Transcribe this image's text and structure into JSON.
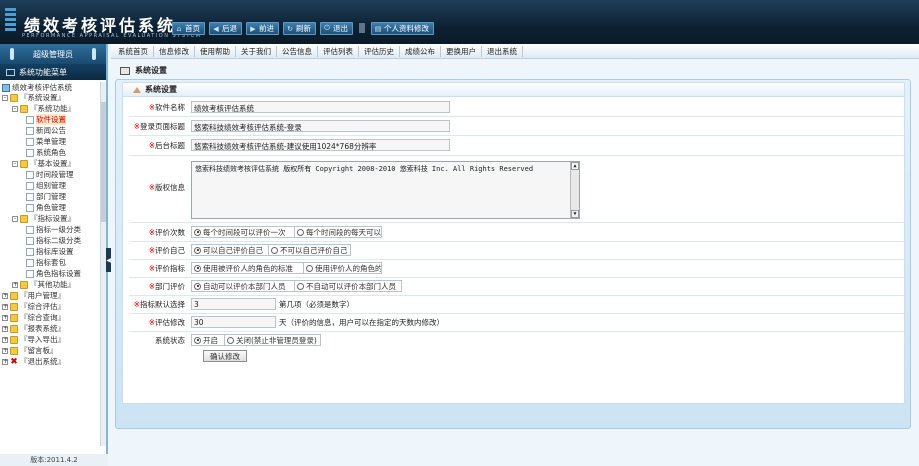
{
  "header": {
    "app_title": "绩效考核评估系统",
    "app_subtitle": "PERFORMANCE APPRAISAL EVALUATION SYSTEM",
    "buttons": [
      {
        "label": "首页",
        "icon": "home-icon"
      },
      {
        "label": "后退",
        "icon": "back-icon"
      },
      {
        "label": "前进",
        "icon": "forward-icon"
      },
      {
        "label": "刷新",
        "icon": "refresh-icon"
      },
      {
        "label": "退出",
        "icon": "power-icon"
      },
      {
        "label": "个人资料修改",
        "icon": "profile-icon"
      }
    ]
  },
  "sidebar": {
    "user_role": "超级管理员",
    "menu_header": "系统功能菜单",
    "version": "版本:2011.4.2",
    "tree": [
      {
        "label": "绩效考核评估系统",
        "level": 0,
        "icon": "pc"
      },
      {
        "label": "『系统设置』",
        "level": 0,
        "icon": "folder",
        "toggle": "-"
      },
      {
        "label": "『系统功能』",
        "level": 1,
        "icon": "folder",
        "toggle": "-"
      },
      {
        "label": "软件设置",
        "level": 2,
        "icon": "page",
        "selected": true
      },
      {
        "label": "新闻公告",
        "level": 2,
        "icon": "page"
      },
      {
        "label": "菜单管理",
        "level": 2,
        "icon": "page"
      },
      {
        "label": "系统角色",
        "level": 2,
        "icon": "page"
      },
      {
        "label": "『基本设置』",
        "level": 1,
        "icon": "folder",
        "toggle": "-"
      },
      {
        "label": "时间段管理",
        "level": 2,
        "icon": "page"
      },
      {
        "label": "组别管理",
        "level": 2,
        "icon": "page"
      },
      {
        "label": "部门管理",
        "level": 2,
        "icon": "page"
      },
      {
        "label": "角色管理",
        "level": 2,
        "icon": "page"
      },
      {
        "label": "『指标设置』",
        "level": 1,
        "icon": "folder",
        "toggle": "-"
      },
      {
        "label": "指标一级分类",
        "level": 2,
        "icon": "page"
      },
      {
        "label": "指标二级分类",
        "level": 2,
        "icon": "page"
      },
      {
        "label": "指标库设置",
        "level": 2,
        "icon": "page"
      },
      {
        "label": "指标套包",
        "level": 2,
        "icon": "page"
      },
      {
        "label": "角色指标设置",
        "level": 2,
        "icon": "page"
      },
      {
        "label": "『其他功能』",
        "level": 1,
        "icon": "folder",
        "toggle": "+"
      },
      {
        "label": "『用户管理』",
        "level": 0,
        "icon": "folder",
        "toggle": "+"
      },
      {
        "label": "『综合评估』",
        "level": 0,
        "icon": "folder",
        "toggle": "+"
      },
      {
        "label": "『综合查询』",
        "level": 0,
        "icon": "folder",
        "toggle": "+"
      },
      {
        "label": "『报表系统』",
        "level": 0,
        "icon": "folder",
        "toggle": "+"
      },
      {
        "label": "『导入导出』",
        "level": 0,
        "icon": "folder",
        "toggle": "+"
      },
      {
        "label": "『留言板』",
        "level": 0,
        "icon": "folder",
        "toggle": "+"
      },
      {
        "label": "『退出系统』",
        "level": 0,
        "icon": "red",
        "toggle": "+"
      }
    ]
  },
  "main_nav": [
    "系统首页",
    "信息修改",
    "使用帮助",
    "关于我们",
    "公告信息",
    "评估列表",
    "评估历史",
    "成绩公布",
    "更换用户",
    "退出系统"
  ],
  "breadcrumb": "系统设置",
  "section_title": "系统设置",
  "form": {
    "software_name_label": "软件名称",
    "software_name_value": "绩效考核评估系统",
    "login_title_label": "登录页面标题",
    "login_title_value": "悠索科技绩效考核评估系统-登录",
    "admin_title_label": "后台标题",
    "admin_title_value": "悠索科技绩效考核评估系统-建议使用1024*768分辨率",
    "copyright_label": "版权信息",
    "copyright_value": "悠索科技绩效考核评估系统 版权所有 Copyright 2008-2010 悠索科技 Inc. All Rights Reserved",
    "eval_count_label": "评价次数",
    "eval_count_opt1": "每个时间段可以评价一次",
    "eval_count_opt2": "每个时间段的每天可以",
    "eval_self_label": "评价自己",
    "eval_self_opt1": "可以自己评价自己",
    "eval_self_opt2": "不可以自己评价自己",
    "eval_index_label": "评价指标",
    "eval_index_opt1": "使用被评价人的角色的标准",
    "eval_index_opt2": "使用评价人的角色的",
    "dept_eval_label": "部门评价",
    "dept_eval_opt1": "自动可以评价本部门人员",
    "dept_eval_opt2": "不自动可以评价本部门人员",
    "index_default_label": "指标默认选择",
    "index_default_value": "3",
    "index_default_hint": "第几项（必须是数字）",
    "eval_modify_label": "评估修改",
    "eval_modify_value": "30",
    "eval_modify_hint": "天（评价的信息，用户可以在指定的天数内修改）",
    "system_status_label": "系统状态",
    "system_status_opt1": "开启",
    "system_status_opt2": "关闭(禁止非管理员登录)",
    "submit_label": "确认修改"
  }
}
